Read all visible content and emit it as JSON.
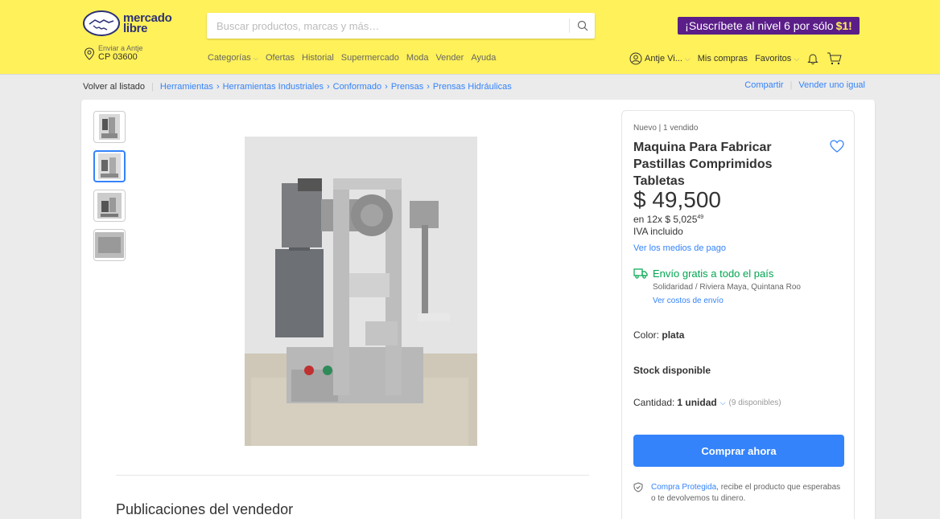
{
  "header": {
    "logo": "mercado libre",
    "search": {
      "placeholder": "Buscar productos, marcas y más…"
    },
    "promo": {
      "text": "¡Suscríbete al nivel 6 por sólo",
      "highlight": "$1!"
    },
    "ship_to": {
      "label": "Enviar a Antje",
      "cp": "CP 03600"
    },
    "nav": [
      "Categorías",
      "Ofertas",
      "Historial",
      "Supermercado",
      "Moda",
      "Vender",
      "Ayuda"
    ],
    "user": {
      "name": "Antje Vi...",
      "purchases": "Mis compras",
      "favorites": "Favoritos"
    }
  },
  "breadcrumb": {
    "back": "Volver al listado",
    "items": [
      "Herramientas",
      "Herramientas Industriales",
      "Conformado",
      "Prensas",
      "Prensas Hidráulicas"
    ],
    "share": "Compartir",
    "sell": "Vender uno igual"
  },
  "product": {
    "subtitle": "Nuevo | 1 vendido",
    "title": "Maquina Para Fabricar Pastillas Comprimidos Tabletas",
    "price": "$ 49,500",
    "installments_prefix": "en 12x $ 5,025",
    "installments_cents": "49",
    "iva": "IVA incluido",
    "payment_link": "Ver los medios de pago",
    "shipping": {
      "free": "Envío gratis a todo el país",
      "location": "Solidaridad / Riviera Maya, Quintana Roo",
      "costs_link": "Ver costos de envío"
    },
    "color_label": "Color:",
    "color_value": "plata",
    "stock": "Stock disponible",
    "quantity_label": "Cantidad:",
    "quantity_value": "1 unidad",
    "quantity_available": "(9 disponibles)",
    "buy_button": "Comprar ahora",
    "protection_link": "Compra Protegida",
    "protection_text": ", recibe el producto que esperabas o te devolvemos tu dinero."
  },
  "seller_publications": "Publicaciones del vendedor",
  "colors": {
    "header": "#fff159",
    "accent": "#3483fa",
    "promo": "#5b1e88",
    "success": "#00a650"
  }
}
